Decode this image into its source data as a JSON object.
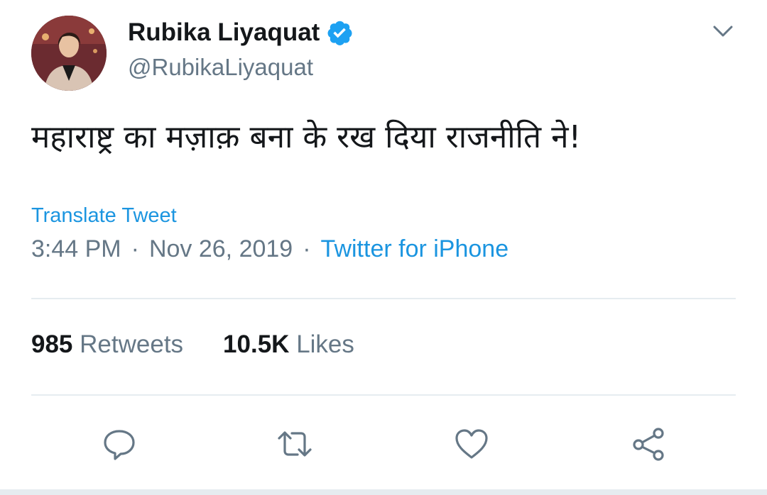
{
  "author": {
    "display_name": "Rubika Liyaquat",
    "handle": "@RubikaLiyaquat",
    "verified": true,
    "avatar_icon": "profile-photo"
  },
  "tweet": {
    "text": "महाराष्ट्र का मज़ाक़ बना के रख दिया राजनीति ने!",
    "translate_label": "Translate Tweet",
    "time": "3:44 PM",
    "date": "Nov 26, 2019",
    "source": "Twitter for iPhone"
  },
  "stats": {
    "retweets_count": "985",
    "retweets_label": "Retweets",
    "likes_count": "10.5K",
    "likes_label": "Likes"
  },
  "actions": [
    "reply-icon",
    "retweet-icon",
    "like-icon",
    "share-icon"
  ],
  "colors": {
    "link": "#1b95e0",
    "muted": "#657786",
    "text": "#14171a",
    "divider": "#e6ecf0"
  }
}
